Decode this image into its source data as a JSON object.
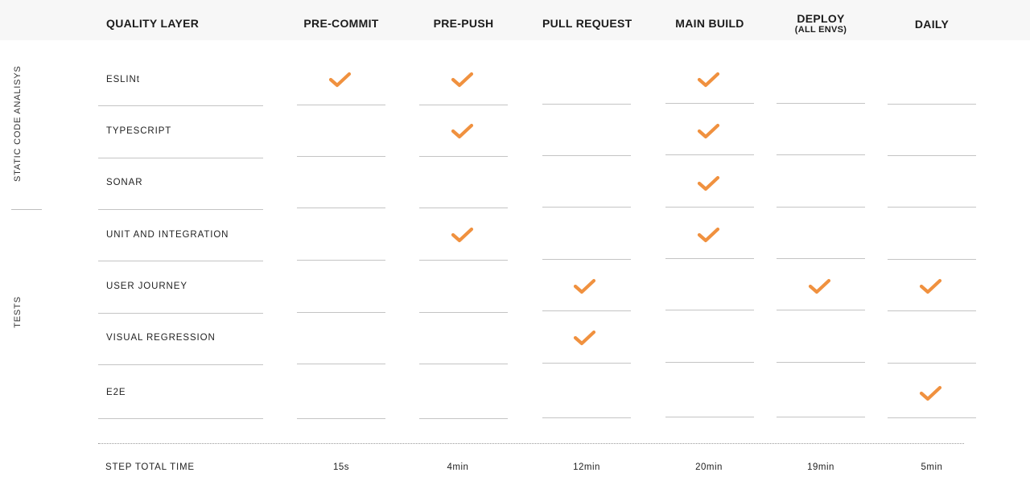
{
  "headers": {
    "quality_layer": "QUALITY LAYER",
    "columns": [
      {
        "label": "PRE-COMMIT",
        "sub": ""
      },
      {
        "label": "PRE-PUSH",
        "sub": ""
      },
      {
        "label": "PULL REQUEST",
        "sub": ""
      },
      {
        "label": "MAIN BUILD",
        "sub": ""
      },
      {
        "label": "DEPLOY",
        "sub": "(ALL ENVS)"
      },
      {
        "label": "DAILY",
        "sub": ""
      }
    ]
  },
  "groups": {
    "static": "STATIC CODE ANALISYS",
    "tests": "TESTS"
  },
  "rows": [
    {
      "label": "ESLINt",
      "checks": [
        true,
        true,
        false,
        true,
        false,
        false
      ]
    },
    {
      "label": "TYPESCRIPT",
      "checks": [
        false,
        true,
        false,
        true,
        false,
        false
      ]
    },
    {
      "label": "SONAR",
      "checks": [
        false,
        false,
        false,
        true,
        false,
        false
      ]
    },
    {
      "label": "UNIT AND INTEGRATION",
      "checks": [
        false,
        true,
        false,
        true,
        false,
        false
      ]
    },
    {
      "label": "USER JOURNEY",
      "checks": [
        false,
        false,
        true,
        false,
        true,
        true
      ]
    },
    {
      "label": "VISUAL REGRESSION",
      "checks": [
        false,
        false,
        true,
        false,
        false,
        false
      ]
    },
    {
      "label": "E2E",
      "checks": [
        false,
        false,
        false,
        false,
        false,
        true
      ]
    }
  ],
  "footer": {
    "label": "STEP TOTAL TIME",
    "times": [
      "15s",
      "4min",
      "12min",
      "20min",
      "19min",
      "5min"
    ]
  },
  "colors": {
    "check": "#f0913f",
    "rule": "#c4c4c4",
    "header_band": "#f7f7f7"
  },
  "icons": {
    "check": "check-icon"
  }
}
